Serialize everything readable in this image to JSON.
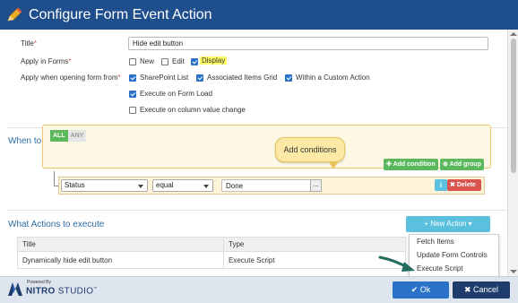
{
  "dialog": {
    "title": "Configure Form Event Action"
  },
  "form": {
    "title_label": "Title",
    "title_value": "Hide edit button",
    "apply_in_forms_label": "Apply in Forms",
    "forms": [
      {
        "label": "New",
        "checked": false
      },
      {
        "label": "Edit",
        "checked": false
      },
      {
        "label": "Display",
        "checked": true
      }
    ],
    "apply_when_label": "Apply when opening form from",
    "sources": [
      {
        "label": "SharePoint List",
        "checked": true
      },
      {
        "label": "Associated Items Grid",
        "checked": true
      },
      {
        "label": "Within a Custom Action",
        "checked": true
      }
    ],
    "execute_on_form_load": {
      "label": "Execute on Form Load",
      "checked": true
    },
    "execute_on_column_change": {
      "label": "Execute on column value change",
      "checked": false
    }
  },
  "when_section": {
    "title": "When to execute Actions",
    "all_label": "ALL",
    "any_label": "ANY",
    "add_condition_label": "Add condition",
    "add_group_label": "Add group",
    "rule": {
      "field": "Status",
      "operator": "equal",
      "value": "Done",
      "more_label": "...",
      "info_label": "i",
      "delete_label": "Delete"
    },
    "tooltip": "Add conditions"
  },
  "actions_section": {
    "title": "What Actions to execute",
    "new_action_label": "+ New Action ▾",
    "table": {
      "columns": [
        "Title",
        "Type"
      ],
      "rows": [
        [
          "Dynamically hide edit button",
          "Execute Script"
        ]
      ]
    },
    "menu_items": [
      "Fetch Items",
      "Update Form Controls",
      "Execute Script"
    ]
  },
  "footer": {
    "powered_by": "Powered By",
    "brand_bold": "NITRO",
    "brand_rest": "STUDIO",
    "ok_label": "Ok",
    "cancel_label": "Cancel"
  },
  "colors": {
    "header_bg": "#1f4e8c",
    "primary": "#2a72c8",
    "success": "#5cb85c",
    "info": "#5bc0de",
    "danger": "#d9534f",
    "tooltip_bg": "#fde9a6"
  }
}
